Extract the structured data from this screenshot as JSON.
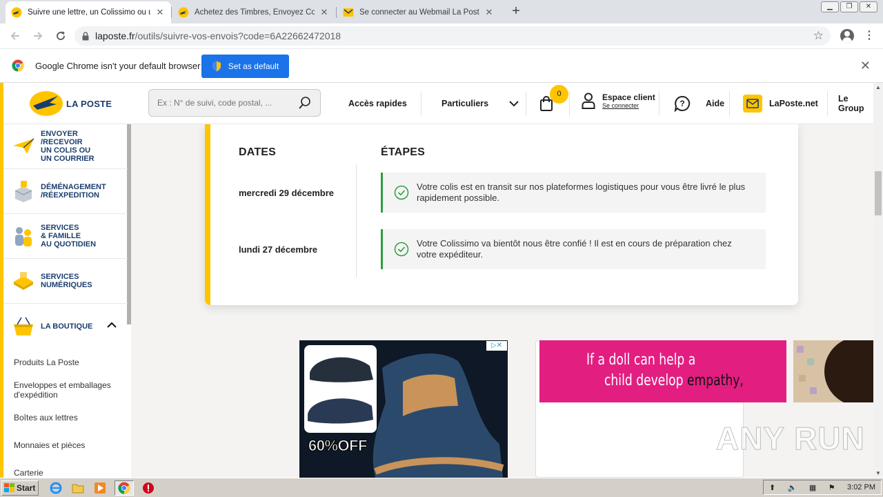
{
  "browser": {
    "tabs": [
      {
        "title": "Suivre une lettre, un Colissimo ou un",
        "active": true
      },
      {
        "title": "Achetez des Timbres, Envoyez Courri",
        "active": false
      },
      {
        "title": "Se connecter au Webmail La Poste –",
        "active": false
      }
    ],
    "new_tab": "+",
    "close_glyph": "✕",
    "url_domain": "laposte.fr",
    "url_path": "/outils/suivre-vos-envois?code=6A22662472018",
    "infobar_message": "Google Chrome isn't your default browser",
    "set_default_label": "Set as default"
  },
  "header": {
    "logo_text": "LA POSTE",
    "search_placeholder": "Ex : N° de suivi, code postal, ...",
    "acces_rapides": "Accès rapides",
    "particuliers": "Particuliers",
    "cart_count": "0",
    "espace_client": "Espace client",
    "se_connecter": "Se connecter",
    "aide": "Aide",
    "laposte_net": "LaPoste.net",
    "le_groupe": "Le Group"
  },
  "sidebar": {
    "items": [
      {
        "label": "ENVOYER\n/RECEVOIR\nUN COLIS OU\nUN COURRIER"
      },
      {
        "label": "DÉMÉNAGEMENT\n/RÉEXPEDITION"
      },
      {
        "label": "SERVICES\n& FAMILLE\nAU QUOTIDIEN"
      },
      {
        "label": "SERVICES\nNUMÉRIQUES"
      },
      {
        "label": "LA BOUTIQUE"
      }
    ],
    "sub_links": [
      "Produits La Poste",
      "Enveloppes et emballages\nd'expédition",
      "Boîtes aux lettres",
      "Monnaies et pièces",
      "Carterie"
    ]
  },
  "tracking": {
    "dates_title": "DATES",
    "steps_title": "ÉTAPES",
    "events": [
      {
        "date": "mercredi 29 décembre",
        "text": "Votre colis est en transit sur nos plateformes logistiques pour vous être livré le plus rapidement possible."
      },
      {
        "date": "lundi 27 décembre",
        "text": "Votre Colissimo va bientôt nous être confié ! Il est en cours de préparation chez votre expéditeur."
      }
    ]
  },
  "ads": {
    "discount": "60%OFF",
    "adchoices": "▷✕",
    "doll_line1": "If a doll can help a",
    "doll_line2_a": "child develop ",
    "doll_line2_b": "empathy,",
    "watermark": "ANY RUN"
  },
  "taskbar": {
    "start": "Start",
    "clock": "3:02 PM"
  },
  "colors": {
    "laposte_yellow": "#ffc400",
    "laposte_blue": "#1b3d6d",
    "chrome_blue": "#1a73e8",
    "step_green": "#2e9e3f",
    "ad_pink": "#e31e81"
  }
}
